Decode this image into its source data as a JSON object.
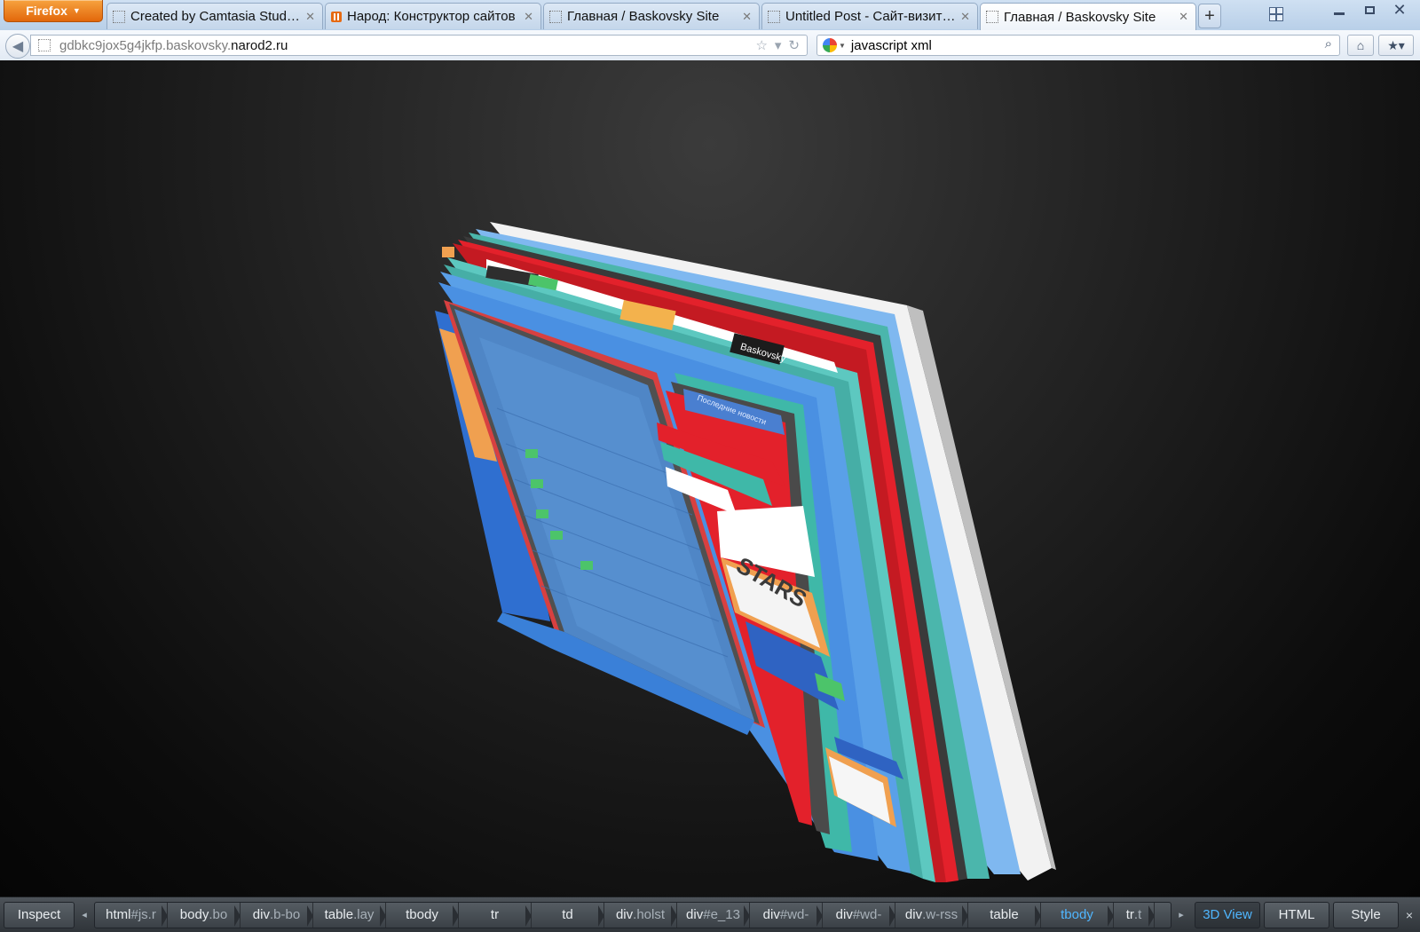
{
  "browser": {
    "menu_button": "Firefox",
    "tabs": [
      {
        "title": "Created by Camtasia Studio 6",
        "favicon": "blank-page-icon"
      },
      {
        "title": "Народ: Конструктор сайтов",
        "favicon": "narod-icon"
      },
      {
        "title": "Главная / Baskovsky Site",
        "favicon": "blank-page-icon"
      },
      {
        "title": "Untitled Post - Сайт-визитка ...",
        "favicon": "blank-page-icon"
      },
      {
        "title": "Главная / Baskovsky Site",
        "favicon": "blank-page-icon",
        "active": true
      }
    ],
    "new_tab": "+",
    "address": {
      "prefix": "gdbkc9jox5g4jkfp.baskovsky.",
      "domain": "narod2.ru"
    },
    "search": {
      "engine": "google-icon",
      "query": "javascript xml"
    }
  },
  "viewport": {
    "label_tags": [
      "Baskovsky",
      "Последние новости",
      "STARS"
    ]
  },
  "inspector": {
    "inspect_label": "Inspect",
    "breadcrumbs": [
      {
        "tag": "html",
        "rest": "#js.r"
      },
      {
        "tag": "body",
        "rest": ".bo"
      },
      {
        "tag": "div",
        "rest": ".b-bo"
      },
      {
        "tag": "table",
        "rest": ".lay"
      },
      {
        "tag": "tbody",
        "rest": ""
      },
      {
        "tag": "tr",
        "rest": ""
      },
      {
        "tag": "td",
        "rest": ""
      },
      {
        "tag": "div",
        "rest": ".holst"
      },
      {
        "tag": "div",
        "rest": "#e_13"
      },
      {
        "tag": "div",
        "rest": "#wd-"
      },
      {
        "tag": "div",
        "rest": "#wd-"
      },
      {
        "tag": "div",
        "rest": ".w-rss"
      },
      {
        "tag": "table",
        "rest": ""
      },
      {
        "tag": "tbody",
        "rest": "",
        "selected": true
      },
      {
        "tag": "tr",
        "rest": ".t"
      }
    ],
    "view_3d": "3D View",
    "html": "HTML",
    "style": "Style",
    "close": "×"
  },
  "colors": {
    "selected_crumb": "#4fb6ff",
    "firefox_orange": "#e2670b",
    "layer_blue": "#4a90e2",
    "layer_teal": "#3fb8a8",
    "layer_red": "#e3212b"
  }
}
